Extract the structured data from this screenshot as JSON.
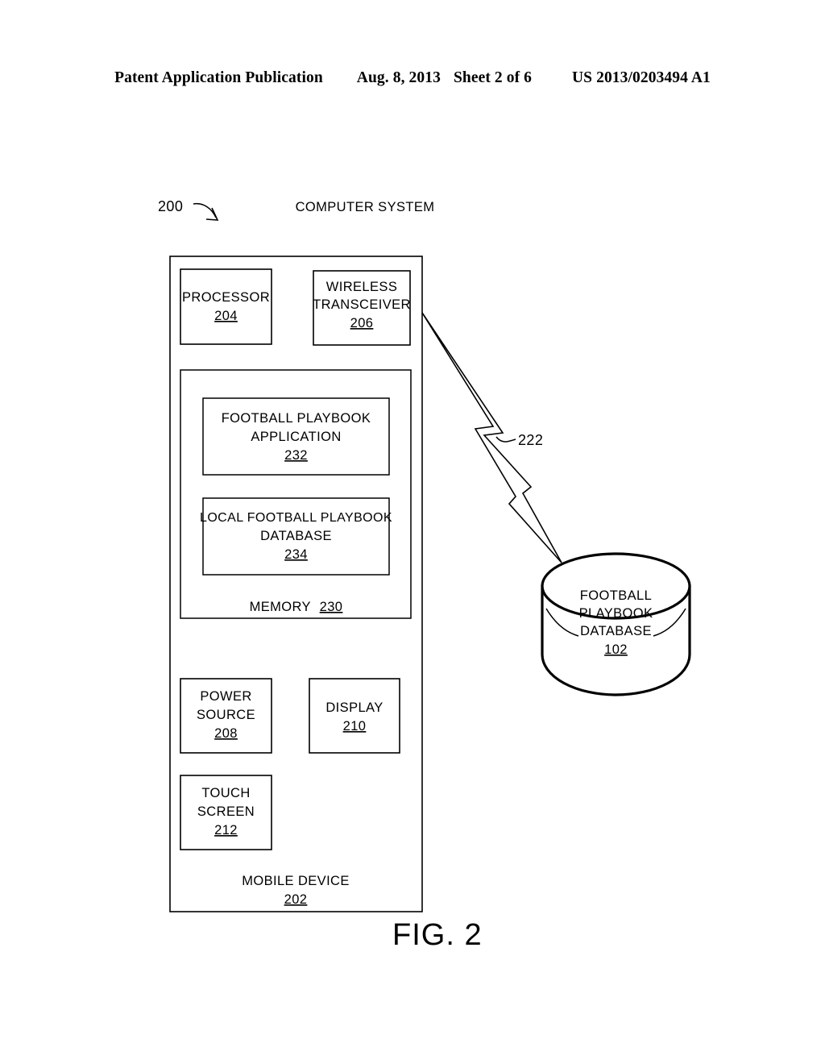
{
  "header": {
    "publication": "Patent Application Publication",
    "date": "Aug. 8, 2013",
    "sheet": "Sheet 2 of 6",
    "patent_number": "US 2013/0203494 A1"
  },
  "figure": {
    "caption": "FIG. 2",
    "system_label": "COMPUTER SYSTEM",
    "system_ref": "200",
    "link_ref": "222"
  },
  "mobile_device": {
    "label": "MOBILE DEVICE",
    "ref": "202"
  },
  "processor": {
    "label": "PROCESSOR",
    "ref": "204"
  },
  "transceiver": {
    "line1": "WIRELESS",
    "line2": "TRANSCEIVER",
    "ref": "206"
  },
  "memory": {
    "label": "MEMORY",
    "ref": "230"
  },
  "application": {
    "line1": "FOOTBALL PLAYBOOK",
    "line2": "APPLICATION",
    "ref": "232"
  },
  "local_database": {
    "line1": "LOCAL FOOTBALL PLAYBOOK",
    "line2": "DATABASE",
    "ref": "234"
  },
  "power_source": {
    "line1": "POWER",
    "line2": "SOURCE",
    "ref": "208"
  },
  "display": {
    "label": "DISPLAY",
    "ref": "210"
  },
  "touch_screen": {
    "line1": "TOUCH",
    "line2": "SCREEN",
    "ref": "212"
  },
  "remote_database": {
    "line1": "FOOTBALL",
    "line2": "PLAYBOOK",
    "line3": "DATABASE",
    "ref": "102"
  }
}
